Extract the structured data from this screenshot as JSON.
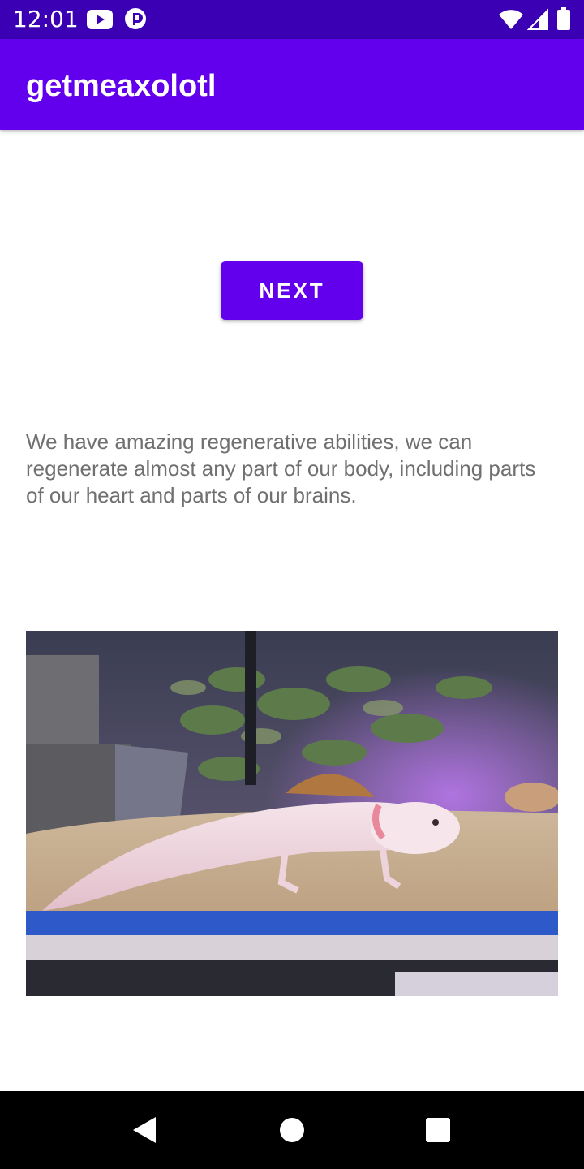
{
  "status_bar": {
    "time": "12:01",
    "icons": [
      "youtube-icon",
      "pocket-casts-icon",
      "wifi-icon",
      "signal-icon",
      "battery-icon"
    ]
  },
  "app_bar": {
    "title": "getmeaxolotl",
    "color": "#6200ee"
  },
  "main": {
    "next_button_label": "NEXT",
    "fact_text": "We have amazing regenerative abilities, we can regenerate almost any part of our body, including parts of our heart and parts of our brains.",
    "image_subject": "axolotl-in-aquarium"
  },
  "nav_bar": {
    "buttons": [
      "back-icon",
      "home-icon",
      "recents-icon"
    ]
  },
  "colors": {
    "status_bar": "#3b00b3",
    "primary": "#6200ee",
    "text_secondary": "#707070",
    "nav_bar": "#000000"
  }
}
